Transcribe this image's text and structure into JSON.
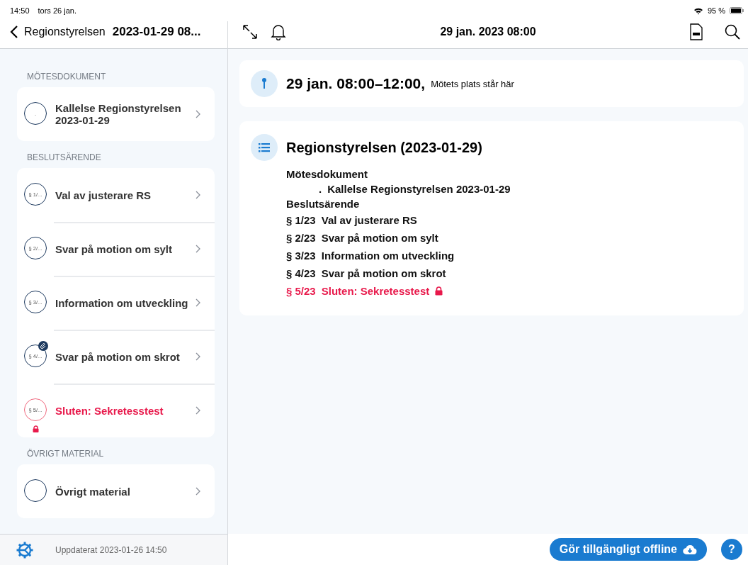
{
  "status_bar": {
    "time": "14:50",
    "date": "tors 26 jan.",
    "battery": "95 %"
  },
  "sidebar": {
    "back_label": "Regionstyrelsen",
    "title": "2023-01-29 08...",
    "sections": [
      {
        "heading": "MÖTESDOKUMENT",
        "items": [
          {
            "badge": ".",
            "title": "Kallelse Regionstyrelsen 2023-01-29",
            "locked": false,
            "attachment": false
          }
        ]
      },
      {
        "heading": "BESLUTSÄRENDE",
        "items": [
          {
            "badge": "§ 1/...",
            "title": "Val av justerare RS",
            "locked": false,
            "attachment": false
          },
          {
            "badge": "§ 2/...",
            "title": "Svar på motion om sylt",
            "locked": false,
            "attachment": false
          },
          {
            "badge": "§ 3/...",
            "title": "Information om utveckling",
            "locked": false,
            "attachment": false
          },
          {
            "badge": "§ 4/...",
            "title": "Svar på motion om skrot",
            "locked": false,
            "attachment": true
          },
          {
            "badge": "§ 5/...",
            "title": "Sluten: Sekretesstest",
            "locked": true,
            "attachment": false
          }
        ]
      },
      {
        "heading": "ÖVRIGT MATERIAL",
        "items": [
          {
            "title": "Övrigt material",
            "locked": false,
            "attachment": false
          }
        ]
      }
    ],
    "updated": "Uppdaterat 2023-01-26 14:50"
  },
  "toolbar": {
    "title": "29 jan. 2023 08:00"
  },
  "meeting": {
    "time": "29 jan. 08:00–12:00,",
    "place": "Mötets plats står här"
  },
  "agenda": {
    "title": "Regionstyrelsen (2023-01-29)",
    "groups": [
      {
        "heading": "Mötesdokument",
        "items": [
          {
            "number": ".",
            "title": "Kallelse Regionstyrelsen 2023-01-29",
            "locked": false
          }
        ],
        "indented": true
      },
      {
        "heading": "Beslutsärende",
        "items": [
          {
            "number": "§ 1/23",
            "title": "Val av justerare RS",
            "locked": false
          },
          {
            "number": "§ 2/23",
            "title": "Svar på motion om sylt",
            "locked": false
          },
          {
            "number": "§ 3/23",
            "title": "Information om utveckling",
            "locked": false
          },
          {
            "number": "§ 4/23",
            "title": "Svar på motion om skrot",
            "locked": false
          },
          {
            "number": "§ 5/23",
            "title": "Sluten: Sekretesstest",
            "locked": true
          }
        ],
        "indented": false
      }
    ]
  },
  "offline_button": "Gör tillgängligt offline",
  "help_button": "?"
}
